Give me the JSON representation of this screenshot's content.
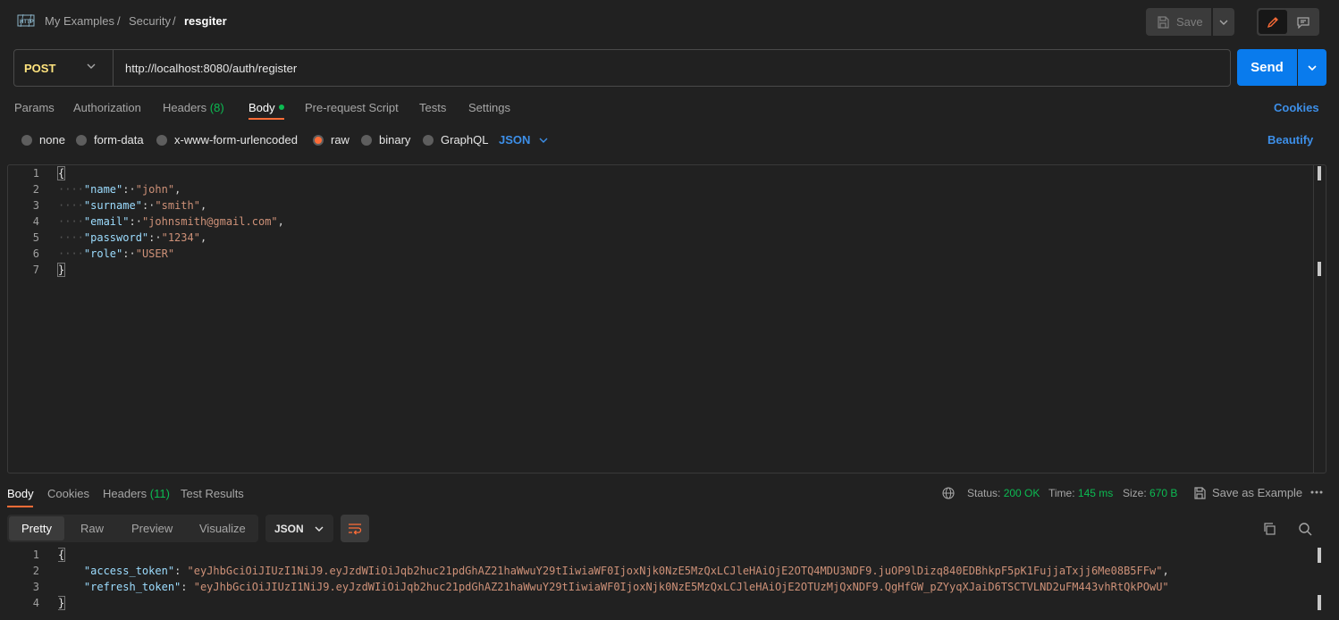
{
  "breadcrumb": {
    "workspace": "My Examples",
    "folder": "Security",
    "request": "resgiter",
    "sep1": "/",
    "sep2": "/"
  },
  "toolbar": {
    "save_label": "Save"
  },
  "request": {
    "method": "POST",
    "url": "http://localhost:8080/auth/register",
    "send_label": "Send"
  },
  "tabs": {
    "params": "Params",
    "authorization": "Authorization",
    "headers": "Headers",
    "headers_count": "(8)",
    "body": "Body",
    "prerequest": "Pre-request Script",
    "tests": "Tests",
    "settings": "Settings",
    "cookies": "Cookies"
  },
  "body_types": {
    "none": "none",
    "form_data": "form-data",
    "urlencoded": "x-www-form-urlencoded",
    "raw": "raw",
    "binary": "binary",
    "graphql": "GraphQL",
    "format": "JSON",
    "beautify": "Beautify",
    "selected": "raw"
  },
  "request_body": {
    "line_numbers": [
      "1",
      "2",
      "3",
      "4",
      "5",
      "6",
      "7"
    ],
    "open": "{",
    "close": "}",
    "fields": [
      {
        "key": "\"name\"",
        "value": "\"john\"",
        "comma": ","
      },
      {
        "key": "\"surname\"",
        "value": "\"smith\"",
        "comma": ","
      },
      {
        "key": "\"email\"",
        "value": "\"johnsmith@gmail.com\"",
        "comma": ","
      },
      {
        "key": "\"password\"",
        "value": "\"1234\"",
        "comma": ","
      },
      {
        "key": "\"role\"",
        "value": "\"USER\"",
        "comma": ""
      }
    ]
  },
  "response_tabs": {
    "body": "Body",
    "cookies": "Cookies",
    "headers": "Headers",
    "headers_count": "(11)",
    "test_results": "Test Results"
  },
  "response_meta": {
    "status_label": "Status:",
    "status_value": "200 OK",
    "time_label": "Time:",
    "time_value": "145 ms",
    "size_label": "Size:",
    "size_value": "670 B",
    "save_example": "Save as Example"
  },
  "response_view": {
    "pretty": "Pretty",
    "raw": "Raw",
    "preview": "Preview",
    "visualize": "Visualize",
    "format": "JSON"
  },
  "response_body": {
    "line_numbers": [
      "1",
      "2",
      "3",
      "4"
    ],
    "open": "{",
    "close": "}",
    "access_key": "\"access_token\"",
    "access_value": "\"eyJhbGciOiJIUzI1NiJ9.eyJzdWIiOiJqb2huc21pdGhAZ21haWwuY29tIiwiaWF0IjoxNjk0NzE5MzQxLCJleHAiOjE2OTQ4MDU3NDF9.juOP9lDizq840EDBhkpF5pK1FujjaTxjj6Me08B5FFw\"",
    "refresh_key": "\"refresh_token\"",
    "refresh_value": "\"eyJhbGciOiJIUzI1NiJ9.eyJzdWIiOiJqb2huc21pdGhAZ21haWwuY29tIiwiaWF0IjoxNjk0NzE5MzQxLCJleHAiOjE2OTUzMjQxNDF9.QgHfGW_pZYyqXJaiD6TSCTVLND2uFM443vhRtQkPOwU\""
  },
  "colors": {
    "accent": "#ff6c37",
    "primary": "#097bed",
    "success": "#0cbb52",
    "method_post": "#ffe47e",
    "link": "#3d8fe8"
  }
}
